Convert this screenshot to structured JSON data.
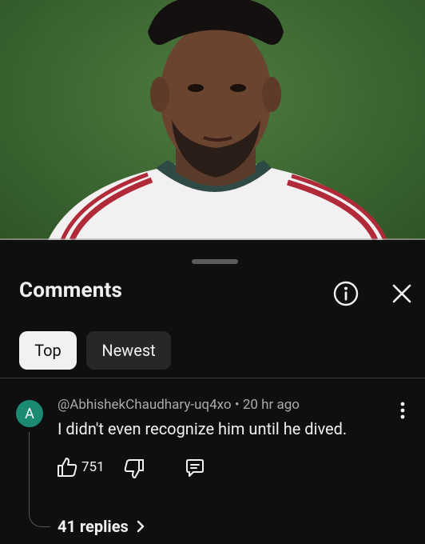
{
  "sheet": {
    "title": "Comments"
  },
  "filters": {
    "top_label": "Top",
    "newest_label": "Newest"
  },
  "comment": {
    "avatar_letter": "A",
    "author": "@AbhishekChaudhary-uq4xo",
    "separator": "•",
    "time": "20 hr ago",
    "text": "I didn't even recognize him until he dived.",
    "like_count": "751",
    "replies_label": "41 replies",
    "avatar_color": "#1a8a73"
  },
  "colors": {
    "background": "#0f0f0f",
    "chip_active": "#f1f1f1",
    "chip_inactive": "#272727"
  }
}
